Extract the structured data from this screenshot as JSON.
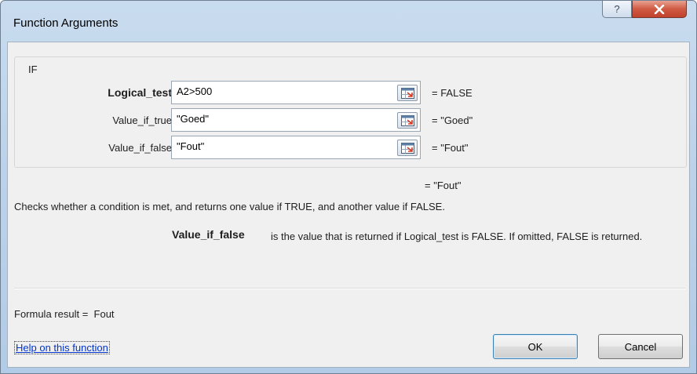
{
  "window": {
    "title": "Function Arguments"
  },
  "titlebar": {
    "help_glyph": "?",
    "close_glyph": "X"
  },
  "group": {
    "label": "IF"
  },
  "arguments": [
    {
      "label": "Logical_test",
      "value": "A2>500",
      "result": "=  FALSE",
      "bold": true
    },
    {
      "label": "Value_if_true",
      "value": "\"Goed\"",
      "result": "=  \"Goed\"",
      "bold": false
    },
    {
      "label": "Value_if_false",
      "value": "\"Fout\"",
      "result": "=  \"Fout\"",
      "bold": false
    }
  ],
  "overall_result": "=  \"Fout\"",
  "function_description": "Checks whether a condition is met, and returns one value if TRUE, and another value if FALSE.",
  "argument_help": {
    "name": "Value_if_false",
    "text": "is the value that is returned if Logical_test is FALSE. If omitted, FALSE is returned."
  },
  "formula_result": {
    "label": "Formula result =",
    "value": "Fout"
  },
  "help_link": "Help on this function",
  "buttons": {
    "ok": "OK",
    "cancel": "Cancel"
  },
  "icons": {
    "collapse": "range-selector-icon",
    "help": "question-mark-icon",
    "close": "close-icon"
  }
}
